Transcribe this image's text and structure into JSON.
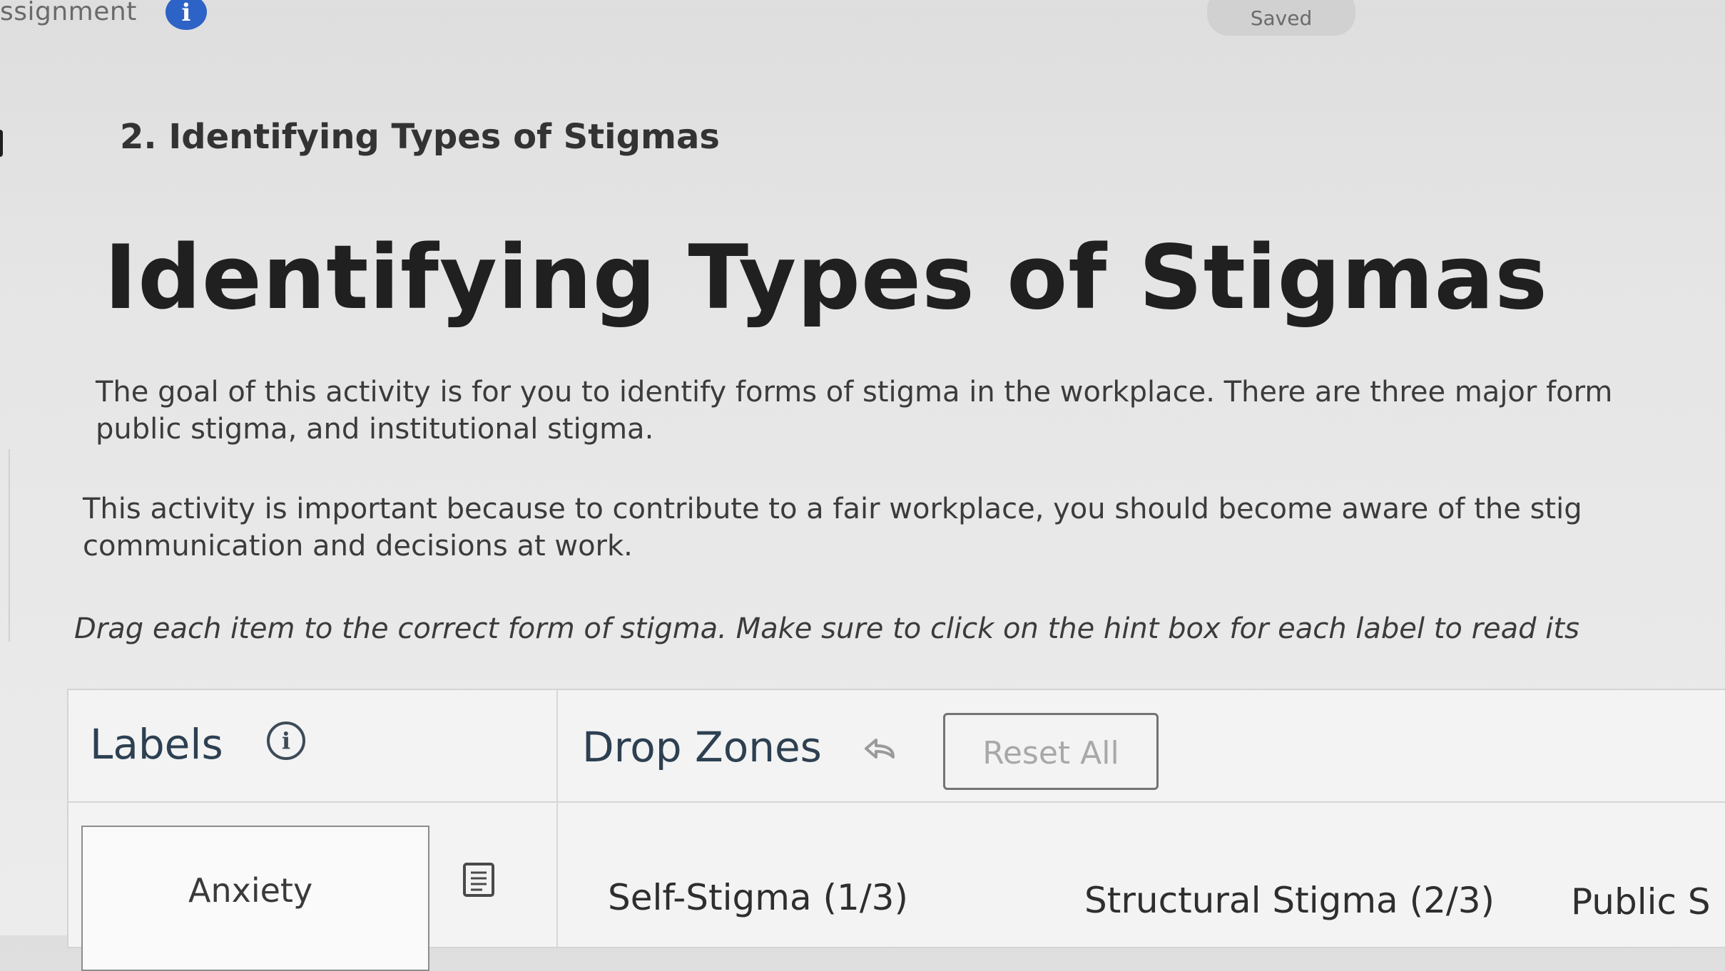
{
  "topbar": {
    "assignment_fragment": "ssignment",
    "info_glyph": "i",
    "save_status": "Saved"
  },
  "question": {
    "number_title": "2. Identifying Types of Stigmas"
  },
  "content": {
    "title": "Identifying Types of Stigmas",
    "paragraph1_line1": "The goal of this activity is for you to identify forms of stigma in the workplace. There are three major form",
    "paragraph1_line2": "public stigma, and institutional stigma.",
    "paragraph2_line1": "This activity is important because to contribute to a fair workplace, you should become aware of the stig",
    "paragraph2_line2": "communication and decisions at work.",
    "instructions": "Drag each item to the correct form of stigma. Make sure to click on the hint box for each label to read its"
  },
  "activity": {
    "labels_heading": "Labels",
    "labels_info_glyph": "i",
    "dropzones_heading": "Drop Zones",
    "reset_label": "Reset All",
    "label_items": [
      {
        "text": "Anxiety"
      }
    ],
    "drop_zones": [
      {
        "text": "Self-Stigma (1/3)"
      },
      {
        "text": "Structural Stigma (2/3)"
      },
      {
        "text": "Public S"
      }
    ]
  },
  "icons": {
    "info": "info-circle-icon",
    "undo": "undo-arrow-icon",
    "hint": "hint-document-icon"
  },
  "colors": {
    "accent_blue": "#2d62c6",
    "heading_dark": "#2d4052",
    "panel_bg": "#f3f3f3"
  }
}
